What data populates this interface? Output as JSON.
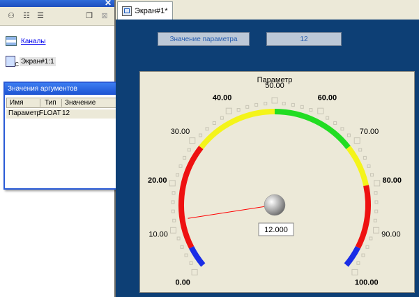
{
  "left": {
    "tree": [
      {
        "label": "Каналы",
        "icon": "channels-icon"
      },
      {
        "label": "Экран#1:1",
        "icon": "screen-icon"
      }
    ],
    "args_window": {
      "title": "Значения аргументов",
      "columns": [
        "Имя",
        "Тип",
        "Значение"
      ],
      "rows": [
        {
          "name": "Параметр",
          "type": "FLOAT",
          "value": "12"
        }
      ]
    }
  },
  "right": {
    "tab_label": "Экран#1*",
    "param_label": "Значение параметра",
    "param_value": "12",
    "gauge": {
      "title": "Параметр",
      "value": 12,
      "value_text": "12.000",
      "min": 0,
      "max": 100,
      "tick_labels": [
        "0.00",
        "10.00",
        "20.00",
        "30.00",
        "40.00",
        "50.00",
        "60.00",
        "70.00",
        "80.00",
        "90.00",
        "100.00"
      ],
      "bold_labels": [
        "0.00",
        "20.00",
        "40.00",
        "60.00",
        "80.00",
        "100.00"
      ],
      "color_bands": [
        {
          "from": 0,
          "to": 5,
          "color": "#1a2de6"
        },
        {
          "from": 5,
          "to": 30,
          "color": "#ee1111"
        },
        {
          "from": 30,
          "to": 50,
          "color": "#f4f41a"
        },
        {
          "from": 50,
          "to": 70,
          "color": "#22dd22"
        },
        {
          "from": 70,
          "to": 80,
          "color": "#f4f41a"
        },
        {
          "from": 80,
          "to": 95,
          "color": "#ee1111"
        },
        {
          "from": 95,
          "to": 100,
          "color": "#1a2de6"
        }
      ],
      "needle_color": "#ff0000"
    }
  }
}
